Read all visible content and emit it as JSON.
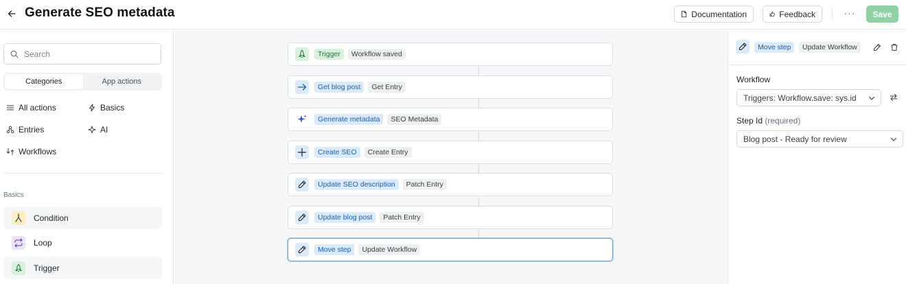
{
  "header": {
    "title": "Generate SEO metadata",
    "documentation_label": "Documentation",
    "feedback_label": "Feedback",
    "more_label": "···",
    "save_label": "Save"
  },
  "sidebar": {
    "search_placeholder": "Search",
    "tabs": [
      {
        "label": "Categories",
        "active": true
      },
      {
        "label": "App actions",
        "active": false
      }
    ],
    "nav": [
      {
        "label": "All actions",
        "icon": "list-icon"
      },
      {
        "label": "Basics",
        "icon": "bolt-icon"
      },
      {
        "label": "Entries",
        "icon": "entries-icon"
      },
      {
        "label": "AI",
        "icon": "sparkle-icon"
      },
      {
        "label": "Workflows",
        "icon": "workflow-icon"
      }
    ],
    "section_label": "Basics",
    "basics": [
      {
        "label": "Condition",
        "icon": "condition-icon",
        "color": "#fbefc2"
      },
      {
        "label": "Loop",
        "icon": "loop-icon",
        "color": "#ebe3fa"
      },
      {
        "label": "Trigger",
        "icon": "trigger-icon",
        "color": "#d8f0dd"
      }
    ]
  },
  "steps": [
    {
      "action": "Trigger",
      "type": "Workflow saved",
      "icon": "trigger-icon",
      "kind": "trigger"
    },
    {
      "action": "Get blog post",
      "type": "Get Entry",
      "icon": "arrow-right-icon",
      "kind": "action"
    },
    {
      "action": "Generate metadata",
      "type": "SEO Metadata",
      "icon": "sparkle-icon",
      "kind": "ai"
    },
    {
      "action": "Create SEO",
      "type": "Create Entry",
      "icon": "plus-icon",
      "kind": "action"
    },
    {
      "action": "Update SEO description",
      "type": "Patch Entry",
      "icon": "pencil-icon",
      "kind": "action"
    },
    {
      "action": "Update blog post",
      "type": "Patch Entry",
      "icon": "pencil-icon",
      "kind": "action"
    },
    {
      "action": "Move step",
      "type": "Update Workflow",
      "icon": "pencil-icon",
      "kind": "action",
      "selected": true
    }
  ],
  "panel": {
    "action": "Move step",
    "type": "Update Workflow",
    "workflow_label": "Workflow",
    "workflow_value": "Triggers: Workflow.save: sys.id",
    "step_id_label": "Step Id",
    "step_id_required": "(required)",
    "step_id_value": "Blog post - Ready for review"
  },
  "colors": {
    "action_tag_bg": "#dbeafb",
    "trigger_tag_bg": "#d8f0dd",
    "save_bg": "#8fd3a5",
    "selected_border": "#6d9fdc"
  }
}
